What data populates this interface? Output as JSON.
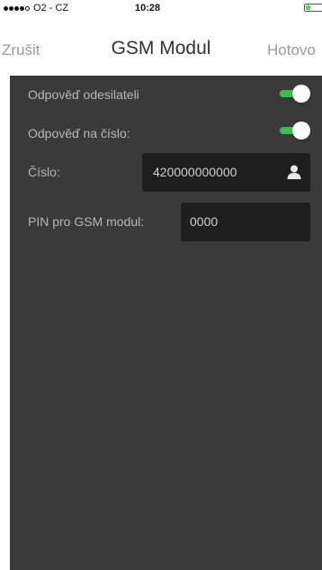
{
  "status_bar": {
    "carrier": "O2 - CZ",
    "time": "10:28",
    "signal_bars_filled": 4,
    "signal_bars_total": 5,
    "battery_level": 0.3,
    "battery_color": "#4cd964"
  },
  "nav": {
    "cancel_label": "Zrušit",
    "title": "GSM Modul",
    "done_label": "Hotovo"
  },
  "settings": {
    "reply_to_sender": {
      "label": "Odpověď odesilateli",
      "enabled": true
    },
    "reply_to_number": {
      "label": "Odpověď na číslo:",
      "enabled": true
    },
    "number": {
      "label": "Číslo:",
      "value": "420000000000",
      "icon": "contact-person-icon"
    },
    "pin": {
      "label": "PIN pro GSM modul:",
      "value": "0000"
    }
  },
  "colors": {
    "toggle_on": "#35c24a",
    "content_background": "#3a3a3a",
    "input_background": "#1e1e1e"
  }
}
